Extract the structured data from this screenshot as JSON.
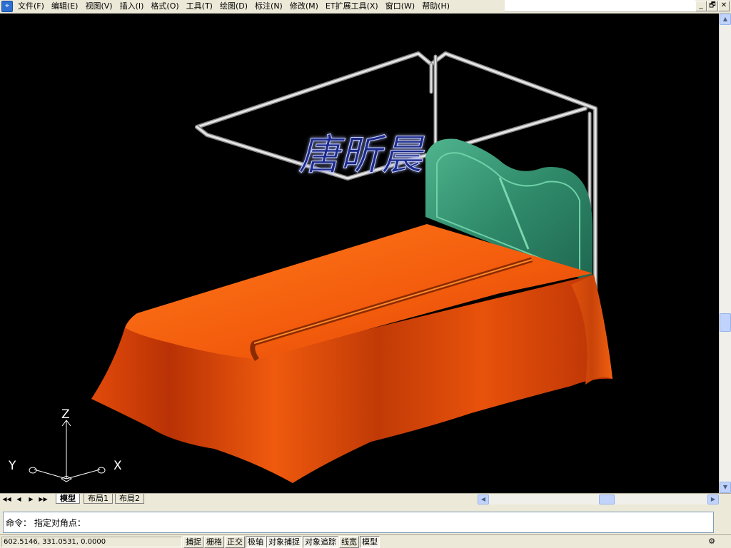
{
  "app": {
    "icon_glyph": "⌖",
    "menus": [
      "文件(F)",
      "编辑(E)",
      "视图(V)",
      "插入(I)",
      "格式(O)",
      "工具(T)",
      "绘图(D)",
      "标注(N)",
      "修改(M)",
      "ET扩展工具(X)",
      "窗口(W)",
      "帮助(H)"
    ],
    "window_controls": [
      "_",
      "🗗",
      "✕"
    ]
  },
  "drawing": {
    "watermark": "唐昕晨",
    "ucs": {
      "x": "X",
      "y": "Y",
      "z": "Z"
    },
    "colors": {
      "background": "#000000",
      "bedspread": "#e84b0a",
      "headboard": "#3a9a7a",
      "canopy": "#d8d8d8"
    }
  },
  "tabs": {
    "nav": [
      "◀◀",
      "◀",
      "▶",
      "▶▶"
    ],
    "layouts": [
      "模型",
      "布局1",
      "布局2"
    ]
  },
  "command": {
    "prompt": "命令：",
    "text": "指定对角点："
  },
  "status": {
    "coords": "602.5146, 331.0531, 0.0000",
    "buttons": [
      {
        "label": "捕捉",
        "on": false
      },
      {
        "label": "栅格",
        "on": false
      },
      {
        "label": "正交",
        "on": false
      },
      {
        "label": "极轴",
        "on": true
      },
      {
        "label": "对象捕捉",
        "on": true
      },
      {
        "label": "对象追踪",
        "on": true
      },
      {
        "label": "线宽",
        "on": false
      },
      {
        "label": "模型",
        "on": true
      }
    ]
  }
}
